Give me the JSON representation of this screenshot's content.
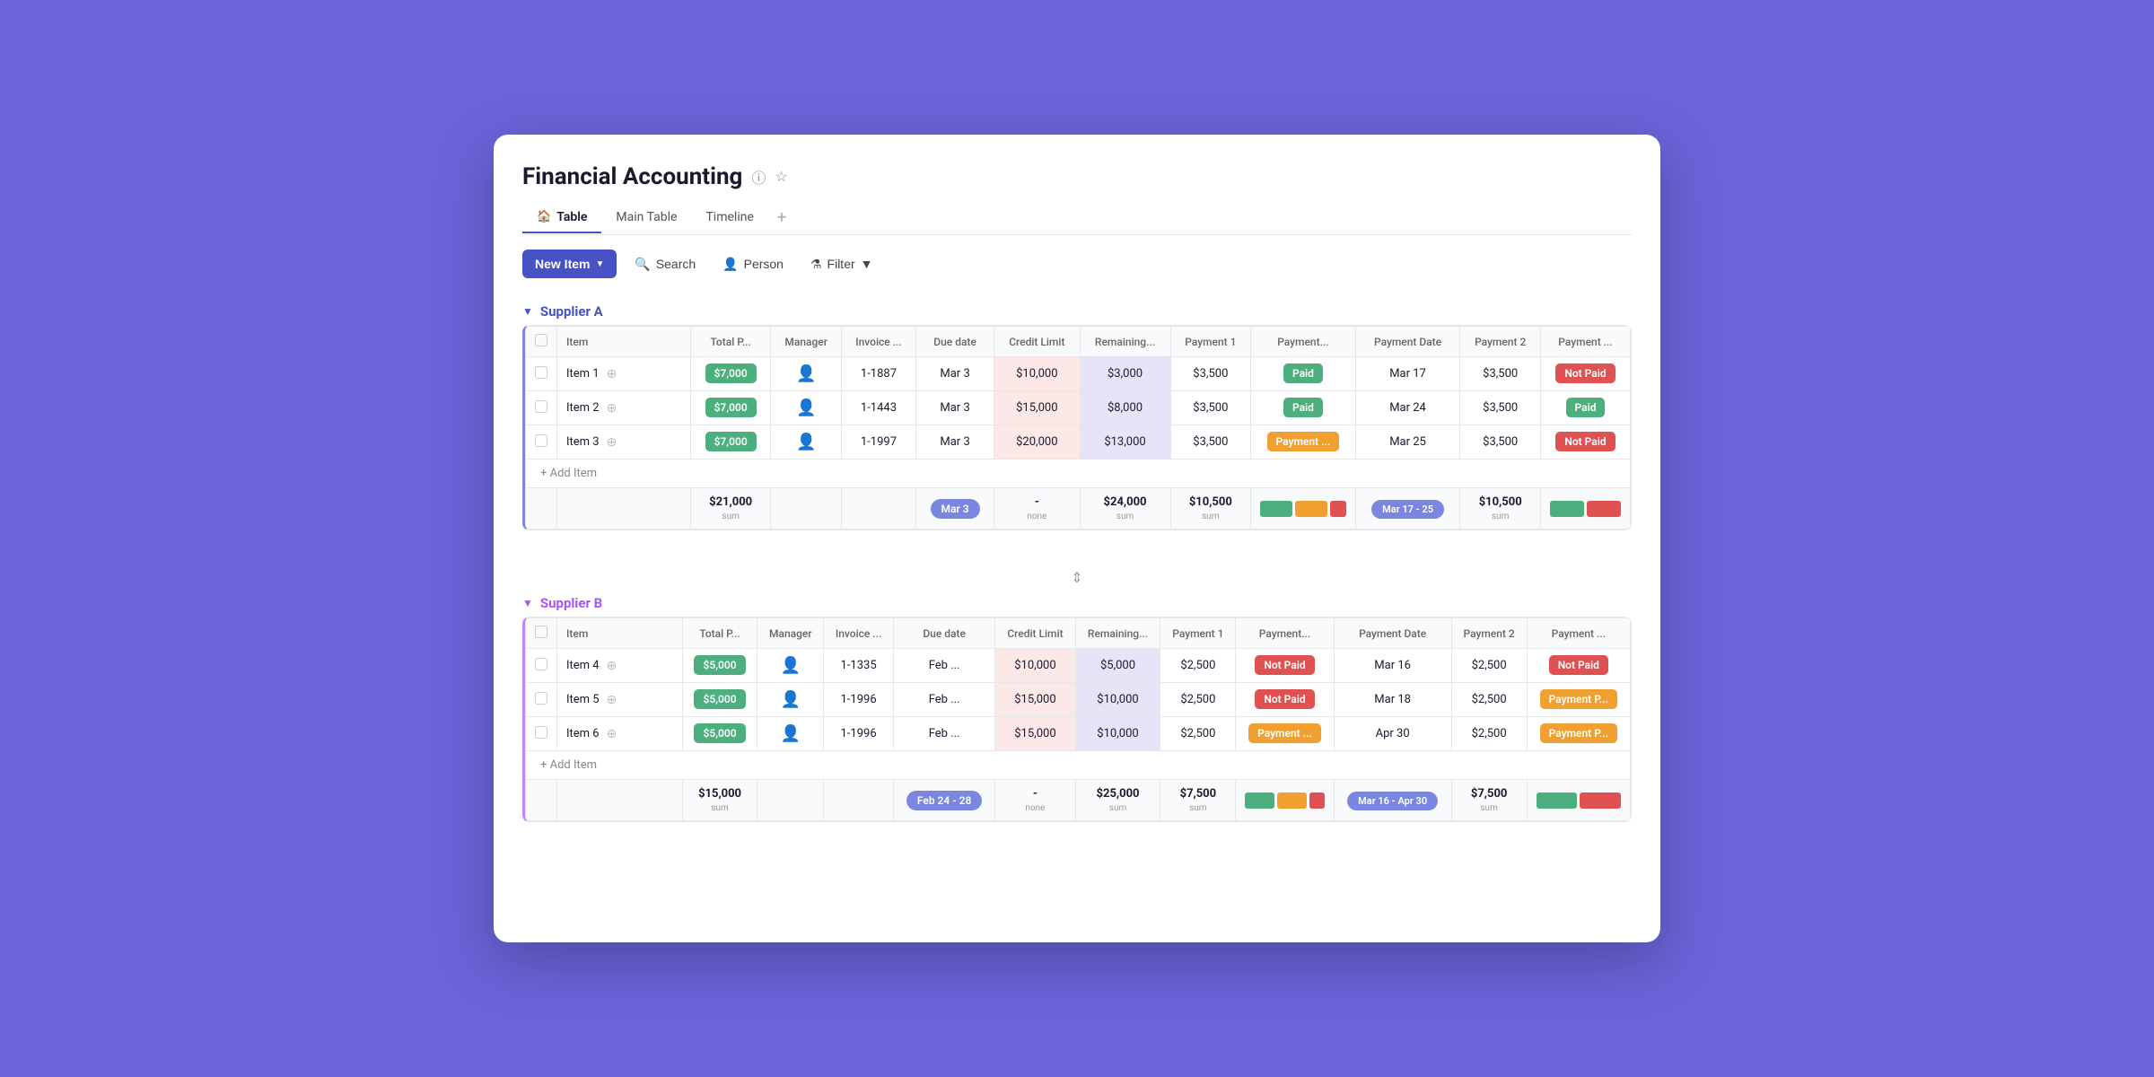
{
  "page": {
    "title": "Financial Accounting",
    "tabs": [
      {
        "label": "Table",
        "icon": "🏠",
        "active": true
      },
      {
        "label": "Main Table",
        "icon": "",
        "active": false
      },
      {
        "label": "Timeline",
        "icon": "",
        "active": false
      }
    ],
    "toolbar": {
      "new_item_label": "New Item",
      "search_label": "Search",
      "person_label": "Person",
      "filter_label": "Filter"
    }
  },
  "supplier_a": {
    "title": "Supplier A",
    "columns": [
      "Item",
      "Total P...",
      "Manager",
      "Invoice ...",
      "Due date",
      "Credit Limit",
      "Remaining...",
      "Payment 1",
      "Payment...",
      "Payment Date",
      "Payment 2",
      "Payment ..."
    ],
    "rows": [
      {
        "item": "Item 1",
        "total_price": "$7,000",
        "manager": "",
        "invoice": "1-1887",
        "due_date": "Mar 3",
        "credit_limit": "$10,000",
        "remaining": "$3,000",
        "payment1": "$3,500",
        "payment1_status": "Paid",
        "payment1_status_type": "green",
        "payment_date": "Mar 17",
        "payment2": "$3,500",
        "payment2_status": "Not Paid",
        "payment2_status_type": "red"
      },
      {
        "item": "Item 2",
        "total_price": "$7,000",
        "manager": "",
        "invoice": "1-1443",
        "due_date": "Mar 3",
        "credit_limit": "$15,000",
        "remaining": "$8,000",
        "payment1": "$3,500",
        "payment1_status": "Paid",
        "payment1_status_type": "green",
        "payment_date": "Mar 24",
        "payment2": "$3,500",
        "payment2_status": "Paid",
        "payment2_status_type": "green"
      },
      {
        "item": "Item 3",
        "total_price": "$7,000",
        "manager": "",
        "invoice": "1-1997",
        "due_date": "Mar 3",
        "credit_limit": "$20,000",
        "remaining": "$13,000",
        "payment1": "$3,500",
        "payment1_status": "Payment ...",
        "payment1_status_type": "orange",
        "payment_date": "Mar 25",
        "payment2": "$3,500",
        "payment2_status": "Not Paid",
        "payment2_status_type": "red"
      }
    ],
    "footer": {
      "total_price_sum": "$21,000",
      "total_price_label": "sum",
      "due_date_badge": "Mar 3",
      "credit_limit_sum": "$24,000",
      "credit_limit_label": "sum",
      "remaining_label": "none",
      "remaining_dash": "-",
      "payment1_sum": "$10,500",
      "payment1_label": "sum",
      "payment_date_range": "Mar 17 - 25",
      "payment2_sum": "$10,500",
      "payment2_label": "sum"
    },
    "add_item_label": "+ Add Item"
  },
  "supplier_b": {
    "title": "Supplier B",
    "columns": [
      "Item",
      "Total P...",
      "Manager",
      "Invoice ...",
      "Due date",
      "Credit Limit",
      "Remaining...",
      "Payment 1",
      "Payment...",
      "Payment Date",
      "Payment 2",
      "Payment ..."
    ],
    "rows": [
      {
        "item": "Item 4",
        "total_price": "$5,000",
        "manager": "",
        "invoice": "1-1335",
        "due_date": "Feb ...",
        "credit_limit": "$10,000",
        "remaining": "$5,000",
        "payment1": "$2,500",
        "payment1_status": "Not Paid",
        "payment1_status_type": "red",
        "payment_date": "Mar 16",
        "payment2": "$2,500",
        "payment2_status": "Not Paid",
        "payment2_status_type": "red"
      },
      {
        "item": "Item 5",
        "total_price": "$5,000",
        "manager": "",
        "invoice": "1-1996",
        "due_date": "Feb ...",
        "credit_limit": "$15,000",
        "remaining": "$10,000",
        "payment1": "$2,500",
        "payment1_status": "Not Paid",
        "payment1_status_type": "red",
        "payment_date": "Mar 18",
        "payment2": "$2,500",
        "payment2_status": "Payment P...",
        "payment2_status_type": "orange"
      },
      {
        "item": "Item 6",
        "total_price": "$5,000",
        "manager": "",
        "invoice": "1-1996",
        "due_date": "Feb ...",
        "credit_limit": "$15,000",
        "remaining": "$10,000",
        "payment1": "$2,500",
        "payment1_status": "Payment ...",
        "payment1_status_type": "orange",
        "payment_date": "Apr 30",
        "payment2": "$2,500",
        "payment2_status": "Payment P...",
        "payment2_status_type": "orange"
      }
    ],
    "footer": {
      "total_price_sum": "$15,000",
      "total_price_label": "sum",
      "due_date_badge": "Feb 24 - 28",
      "credit_limit_sum": "$25,000",
      "credit_limit_label": "sum",
      "remaining_label": "none",
      "remaining_dash": "-",
      "payment1_sum": "$7,500",
      "payment1_label": "sum",
      "payment_date_range": "Mar 16 - Apr 30",
      "payment2_sum": "$7,500",
      "payment2_label": "sum"
    },
    "add_item_label": "+ Add Item"
  }
}
